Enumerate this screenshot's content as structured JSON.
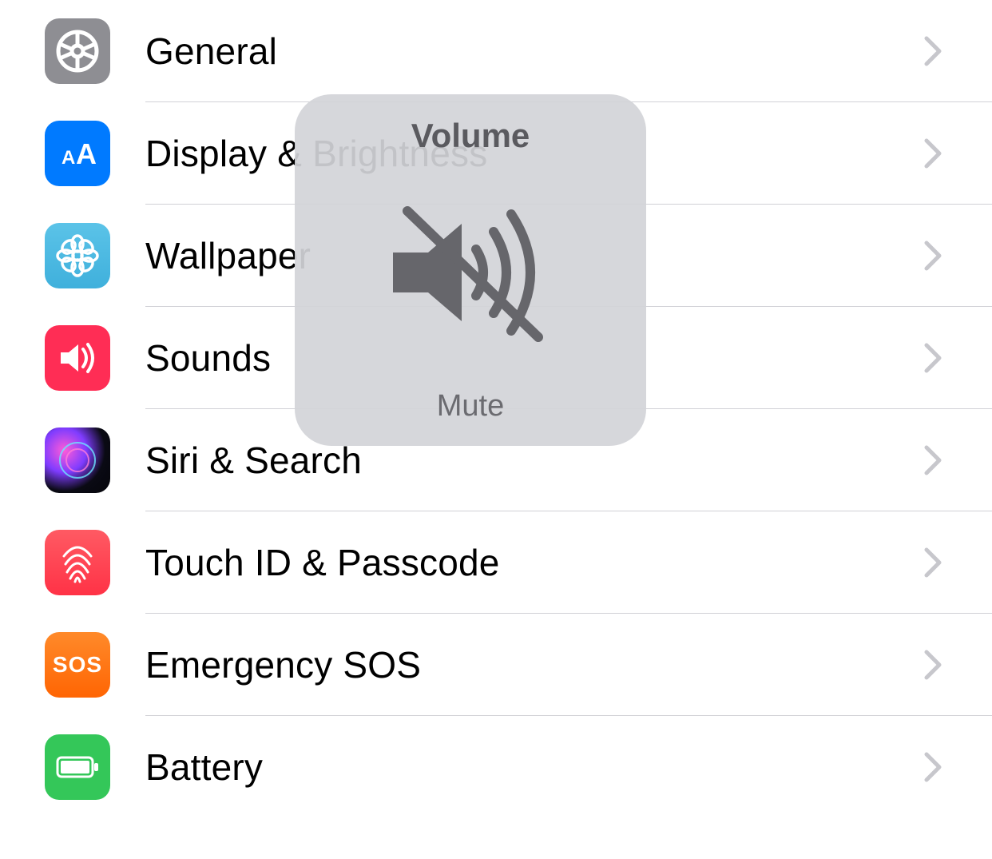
{
  "settings": {
    "items": [
      {
        "id": "general",
        "label": "General"
      },
      {
        "id": "display",
        "label": "Display & Brightness"
      },
      {
        "id": "wallpaper",
        "label": "Wallpaper"
      },
      {
        "id": "sounds",
        "label": "Sounds"
      },
      {
        "id": "siri",
        "label": "Siri & Search"
      },
      {
        "id": "touchid",
        "label": "Touch ID & Passcode"
      },
      {
        "id": "sos",
        "label": "Emergency SOS"
      },
      {
        "id": "battery",
        "label": "Battery"
      }
    ]
  },
  "hud": {
    "title": "Volume",
    "subtitle": "Mute"
  },
  "sos_text": "SOS"
}
